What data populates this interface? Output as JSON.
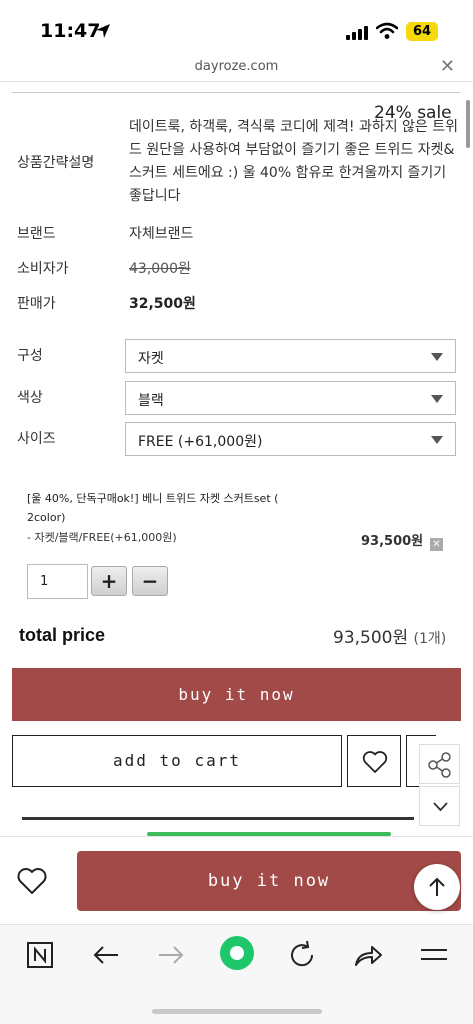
{
  "status_bar": {
    "time": "11:47",
    "battery": "64"
  },
  "browser": {
    "url": "dayroze.com",
    "close_symbol": "✕"
  },
  "product": {
    "sale_badge": "24% sale",
    "description_label": "상품간략설명",
    "description_value": "데이트룩, 하객룩, 격식룩 코디에 제격! 과하지 않은 트위드 원단을 사용하여 부담없이 즐기기 좋은 트위드 자켓&스커트 세트에요 :) 울 40% 함유로 한겨울까지 즐기기 좋답니다",
    "brand_label": "브랜드",
    "brand_value": "자체브랜드",
    "consumer_price_label": "소비자가",
    "consumer_price_value": "43,000원",
    "sale_price_label": "판매가",
    "sale_price_value": "32,500원"
  },
  "options": {
    "composition_label": "구성",
    "composition_value": "자켓",
    "color_label": "색상",
    "color_value": "블랙",
    "size_label": "사이즈",
    "size_value": "FREE (+61,000원)"
  },
  "selected_item": {
    "name": "[울 40%, 단독구매ok!] 베니 트위드 자켓 스커트set ( 2color)",
    "option": "- 자켓/블랙/FREE(+61,000원)",
    "price": "93,500원",
    "remove_symbol": "✕",
    "quantity": "1",
    "plus": "+",
    "minus": "−"
  },
  "total": {
    "label": "total price",
    "value": "93,500원",
    "count": "(1개)"
  },
  "actions": {
    "buy_now": "buy it now",
    "add_to_cart": "add to cart",
    "bottom_buy_now": "buy it now"
  },
  "colors": {
    "accent": "#a24a47",
    "battery": "#f5d90a",
    "green": "#3dbd5a"
  }
}
